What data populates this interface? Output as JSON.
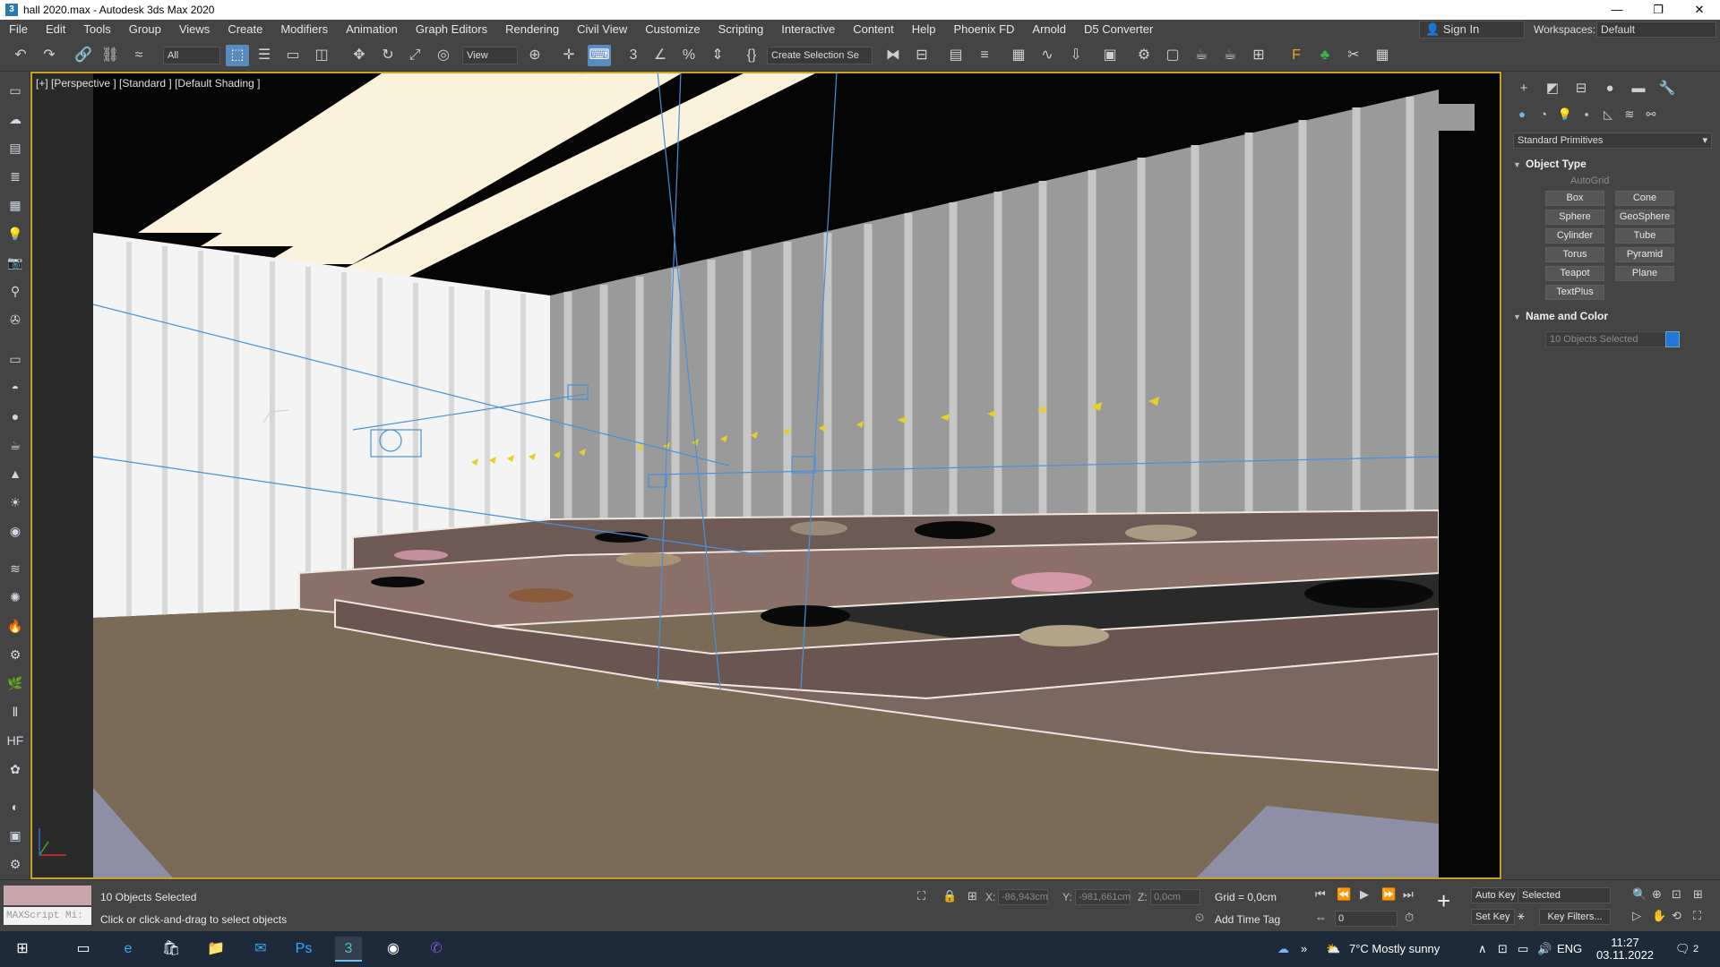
{
  "window": {
    "title": "hall 2020.max - Autodesk 3ds Max 2020",
    "controls": [
      "—",
      "❐",
      "✕"
    ]
  },
  "menu": {
    "items": [
      "File",
      "Edit",
      "Tools",
      "Group",
      "Views",
      "Create",
      "Modifiers",
      "Animation",
      "Graph Editors",
      "Rendering",
      "Civil View",
      "Customize",
      "Scripting",
      "Interactive",
      "Content",
      "Help",
      "Phoenix FD",
      "Arnold",
      "D5 Converter"
    ],
    "sign_in": "Sign In",
    "workspaces_label": "Workspaces:",
    "workspace_value": "Default"
  },
  "toolbar": {
    "selection_filter": "All",
    "ref_coord": "View",
    "named_selection": "Create Selection Se"
  },
  "viewport": {
    "label": "[+] [Perspective ] [Standard ] [Default Shading ]"
  },
  "command_panel": {
    "category": "Standard Primitives",
    "object_type_title": "Object Type",
    "autogrid_label": "AutoGrid",
    "buttons": [
      "Box",
      "Cone",
      "Sphere",
      "GeoSphere",
      "Cylinder",
      "Tube",
      "Torus",
      "Pyramid",
      "Teapot",
      "Plane",
      "TextPlus"
    ],
    "name_color_title": "Name and Color",
    "name_value": "10 Objects Selected",
    "object_color": "#2277dd"
  },
  "status": {
    "listener_text": "MAXScript Mi:",
    "selection_info": "10 Objects Selected",
    "prompt": "Click or click-and-drag to select objects",
    "x_label": "X:",
    "x_value": "-86,943cm",
    "y_label": "Y:",
    "y_value": "-981,661cm",
    "z_label": "Z:",
    "z_value": "0,0cm",
    "grid": "Grid = 0,0cm",
    "add_time_tag": "Add Time Tag",
    "auto_key": "Auto Key",
    "selected_value": "Selected",
    "set_key": "Set Key",
    "key_filters": "Key Filters...",
    "frame": "0"
  },
  "taskbar": {
    "weather": "7°C  Mostly sunny",
    "language": "ENG",
    "time": "11:27",
    "date": "03.11.2022",
    "notifications": "2"
  }
}
